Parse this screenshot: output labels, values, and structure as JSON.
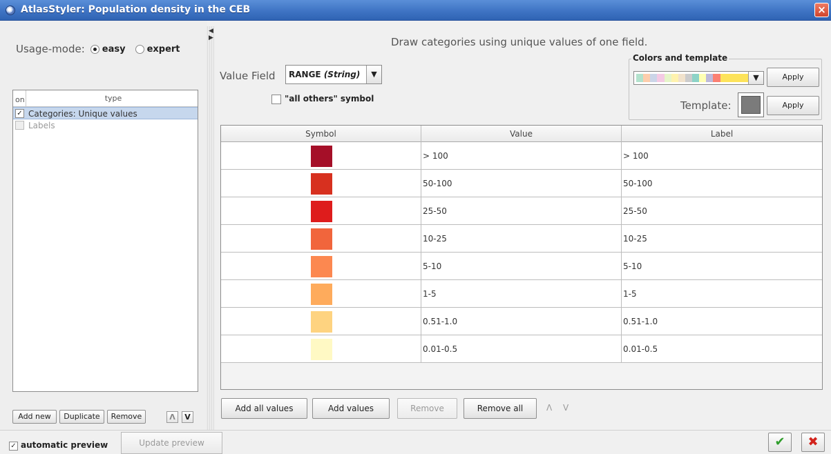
{
  "window": {
    "title": "AtlasStyler: Population density in the CEB",
    "close_icon": "close-icon"
  },
  "left": {
    "usage_label": "Usage-mode:",
    "mode_easy": "easy",
    "mode_expert": "expert",
    "selected_mode": "easy",
    "list_header_on": "on",
    "list_header_type": "type",
    "layers": [
      {
        "label": "Categories: Unique values",
        "checked": true,
        "selected": true
      },
      {
        "label": "Labels",
        "checked": false,
        "selected": false,
        "disabled": true
      }
    ],
    "buttons": {
      "add_new": "Add new",
      "duplicate": "Duplicate",
      "remove": "Remove"
    },
    "up_arrow": "Λ",
    "down_arrow": "V"
  },
  "right": {
    "description": "Draw categories using unique values of one field.",
    "value_field_label": "Value Field",
    "value_field_main": "RANGE",
    "value_field_type": "(String)",
    "all_others_label": "\"all others\" symbol",
    "colors_title": "Colors and template",
    "apply_label": "Apply",
    "template_label": "Template:",
    "palette_colors": [
      "#b3e2cd",
      "#fdcdac",
      "#cbd5e8",
      "#f4cae4",
      "#e6f5c9",
      "#fff2ae",
      "#f1e2cc",
      "#cccccc",
      "#8dd3c7",
      "#ffffb3",
      "#bebada",
      "#fb8072",
      "#fde35a",
      "#fde35a",
      "#fde35a",
      "#fde35a"
    ],
    "template_color": "#7b7b7b",
    "table": {
      "headers": [
        "Symbol",
        "Value",
        "Label"
      ],
      "rows": [
        {
          "color": "#a50f28",
          "value": "> 100",
          "label": "> 100"
        },
        {
          "color": "#d7301f",
          "value": "50-100",
          "label": "50-100"
        },
        {
          "color": "#de1c1c",
          "value": "25-50",
          "label": "25-50"
        },
        {
          "color": "#f1653c",
          "value": "10-25",
          "label": "10-25"
        },
        {
          "color": "#fc8850",
          "value": "5-10",
          "label": "5-10"
        },
        {
          "color": "#feab5c",
          "value": "1-5",
          "label": "1-5"
        },
        {
          "color": "#fed380",
          "value": "0.51-1.0",
          "label": "0.51-1.0"
        },
        {
          "color": "#fff9c4",
          "value": "0.01-0.5",
          "label": "0.01-0.5"
        }
      ]
    },
    "buttons": {
      "add_all": "Add all values",
      "add_values": "Add values",
      "remove": "Remove",
      "remove_all": "Remove all"
    },
    "updown": "Λ V"
  },
  "footer": {
    "automatic_preview": "automatic preview",
    "automatic_preview_checked": true,
    "update_preview": "Update preview",
    "ok_icon": "checkmark-icon",
    "cancel_icon": "x-icon"
  }
}
